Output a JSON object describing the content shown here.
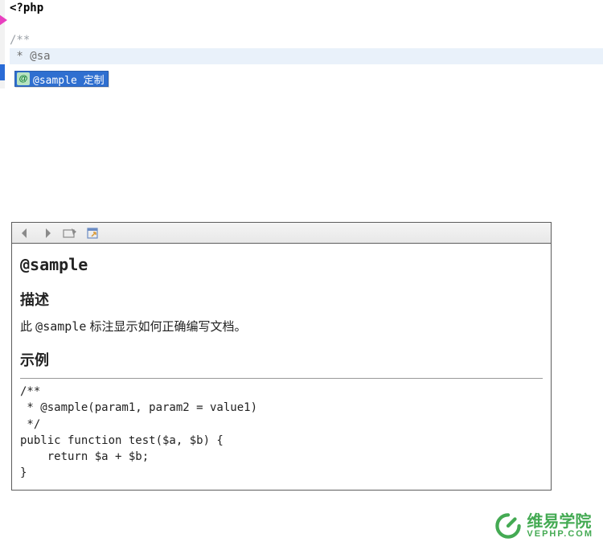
{
  "editor": {
    "lines": [
      {
        "text": "<?php",
        "cls": "kw-bold"
      },
      {
        "text": "",
        "cls": ""
      },
      {
        "text": "/**",
        "cls": "comment-grey"
      },
      {
        "text": " * @sa",
        "cls": "ref-grey",
        "highlight": true
      }
    ],
    "autocomplete": {
      "icon_letter": "@",
      "label": "@sample 定制"
    }
  },
  "doc": {
    "title": "@sample",
    "desc_heading": "描述",
    "desc_text_prefix": "此 ",
    "desc_code": "@sample",
    "desc_text_suffix": " 标注显示如何正确编写文档。",
    "example_heading": "示例",
    "example_code": "/**\n * @sample(param1, param2 = value1)\n */\npublic function test($a, $b) {\n    return $a + $b;\n}"
  },
  "watermark": {
    "cn": "维易学院",
    "en": "VEPHP.COM"
  }
}
